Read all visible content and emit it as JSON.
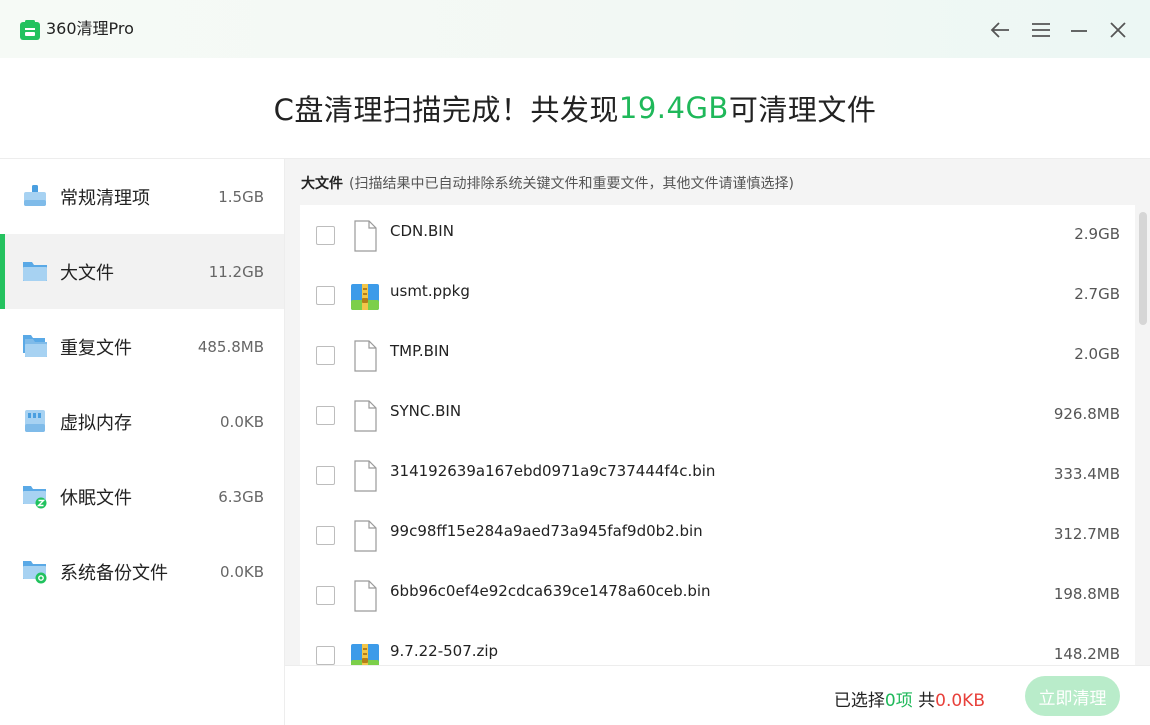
{
  "app": {
    "title": "360清理Pro",
    "accent": "#1fb85a"
  },
  "window_controls": [
    {
      "name": "back-icon"
    },
    {
      "name": "menu-icon"
    },
    {
      "name": "minimize-icon"
    },
    {
      "name": "close-icon"
    }
  ],
  "headline": {
    "prefix": "C盘清理扫描完成！共发现",
    "amount": "19.4GB",
    "suffix": "可清理文件"
  },
  "sidebar": {
    "active_index": 1,
    "items": [
      {
        "label": "常规清理项",
        "size": "1.5GB",
        "icon": "broom-icon"
      },
      {
        "label": "大文件",
        "size": "11.2GB",
        "icon": "folder-icon"
      },
      {
        "label": "重复文件",
        "size": "485.8MB",
        "icon": "folder-duplicate-icon"
      },
      {
        "label": "虚拟内存",
        "size": "0.0KB",
        "icon": "memory-card-icon"
      },
      {
        "label": "休眠文件",
        "size": "6.3GB",
        "icon": "sleep-folder-icon"
      },
      {
        "label": "系统备份文件",
        "size": "0.0KB",
        "icon": "backup-folder-icon"
      }
    ]
  },
  "section": {
    "title": "大文件",
    "note": "(扫描结果中已自动排除系统关键文件和重要文件，其他文件请谨慎选择)"
  },
  "files": [
    {
      "name": "CDN.BIN",
      "size": "2.9GB",
      "icon": "document"
    },
    {
      "name": "usmt.ppkg",
      "size": "2.7GB",
      "icon": "archive"
    },
    {
      "name": "TMP.BIN",
      "size": "2.0GB",
      "icon": "document"
    },
    {
      "name": "SYNC.BIN",
      "size": "926.8MB",
      "icon": "document"
    },
    {
      "name": "314192639a167ebd0971a9c737444f4c.bin",
      "size": "333.4MB",
      "icon": "document"
    },
    {
      "name": "99c98ff15e284a9aed73a945faf9d0b2.bin",
      "size": "312.7MB",
      "icon": "document"
    },
    {
      "name": "6bb96c0ef4e92cdca639ce1478a60ceb.bin",
      "size": "198.8MB",
      "icon": "document"
    },
    {
      "name": "9.7.22-507.zip",
      "size": "148.2MB",
      "icon": "archive"
    }
  ],
  "footer": {
    "selected_prefix": "已选择",
    "selected_count": "0项",
    "total_prefix": "共",
    "total_size": "0.0KB",
    "clean_button": "立即清理"
  }
}
